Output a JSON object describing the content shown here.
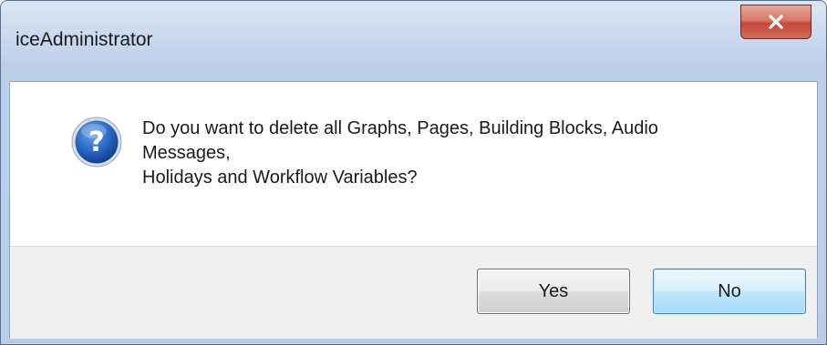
{
  "window": {
    "title": "iceAdministrator",
    "close_icon": "close-icon"
  },
  "dialog": {
    "icon": "question-icon",
    "message_lines": [
      "Do you want to delete all Graphs, Pages, Building Blocks, Audio",
      "Messages,",
      "Holidays and Workflow Variables?"
    ]
  },
  "buttons": {
    "yes_label": "Yes",
    "no_label": "No"
  },
  "colors": {
    "close_button": "#c5463a",
    "icon_blue": "#1f5fb8",
    "default_button_border": "#3c7fb1"
  }
}
